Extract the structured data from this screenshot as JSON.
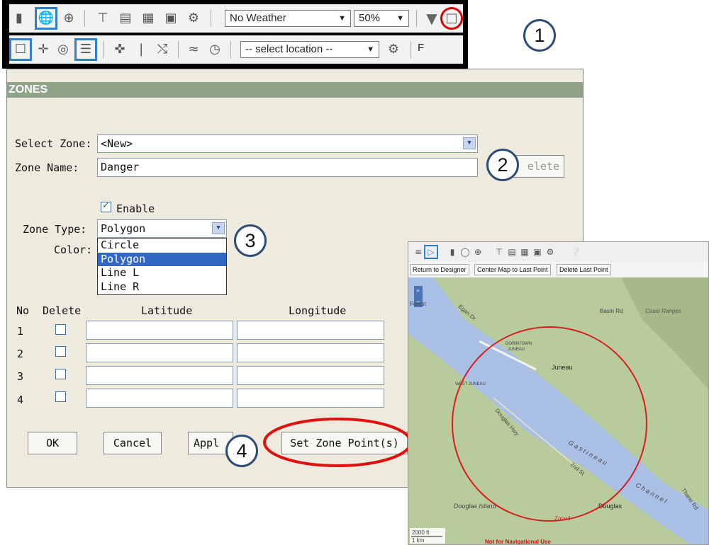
{
  "toolbar": {
    "weather_select": "No Weather",
    "zoom_select": "50%",
    "location_select": "-- select location --",
    "trailing_letter": "F",
    "row1_icons": [
      "vehicle-icon",
      "globe-icon",
      "globe-grid-icon",
      "align-top-icon",
      "align-center-icon",
      "align-text-icon",
      "layout-icon",
      "settings-box-icon",
      "filter-icon",
      "zone-polygon-icon"
    ],
    "row2_icons": [
      "chat-shape-icon",
      "pin-icon",
      "target-icon",
      "list-icon",
      "signpost-icon",
      "route-icon",
      "ruler-icon",
      "terrain-icon",
      "gauge-icon",
      "location-settings-icon"
    ]
  },
  "callouts": [
    "1",
    "2",
    "3",
    "4"
  ],
  "zones": {
    "title": "ZONES",
    "select_zone_label": "Select Zone:",
    "select_zone_value": "<New>",
    "zone_name_label": "Zone Name:",
    "zone_name_value": "Danger",
    "delete_button": "Delete",
    "delete_button_visible": "elete",
    "enable_label": "Enable",
    "enable_checked": true,
    "zone_type_label": "Zone Type:",
    "zone_type_value": "Polygon",
    "color_label": "Color:",
    "zone_type_options": [
      "Circle",
      "Polygon",
      "Line L",
      "Line R"
    ],
    "zone_type_selected": "Polygon",
    "table_headers": {
      "no": "No",
      "delete": "Delete",
      "latitude": "Latitude",
      "longitude": "Longitude"
    },
    "rows": [
      "1",
      "2",
      "3",
      "4"
    ],
    "ok_button": "OK",
    "cancel_button": "Cancel",
    "apply_button": "Apply",
    "apply_button_visible": "Appl",
    "set_points_button": "Set Zone Point(s)"
  },
  "map": {
    "buttons": [
      "Return to Designer",
      "Center Map to Last Point",
      "Delete Last Point"
    ],
    "labels": {
      "forest": "Forest",
      "egan": "Egan Dr",
      "basin": "Basin Rd",
      "coast": "Coast Ranges",
      "downtown": "DOWNTOWN",
      "juneau_small": "JUNEAU",
      "juneau": "Juneau",
      "west_juneau": "WEST JUNEAU",
      "douglas_hwy": "Douglas Hwy",
      "gastineau": "G a s t i n e a u",
      "channel": "C h a n n e l",
      "thane": "Thane Rd",
      "second_st": "2nd St",
      "douglas_island": "Douglas Island",
      "zone4": "Zone4",
      "douglas": "Douglas",
      "scale_ft": "2000 ft",
      "scale_km": "1 km",
      "warning": "Not for Navigational Use"
    },
    "colors": {
      "water": "#a9bfe4",
      "land": "#b8cb9c",
      "circle": "#d81e1e"
    }
  }
}
